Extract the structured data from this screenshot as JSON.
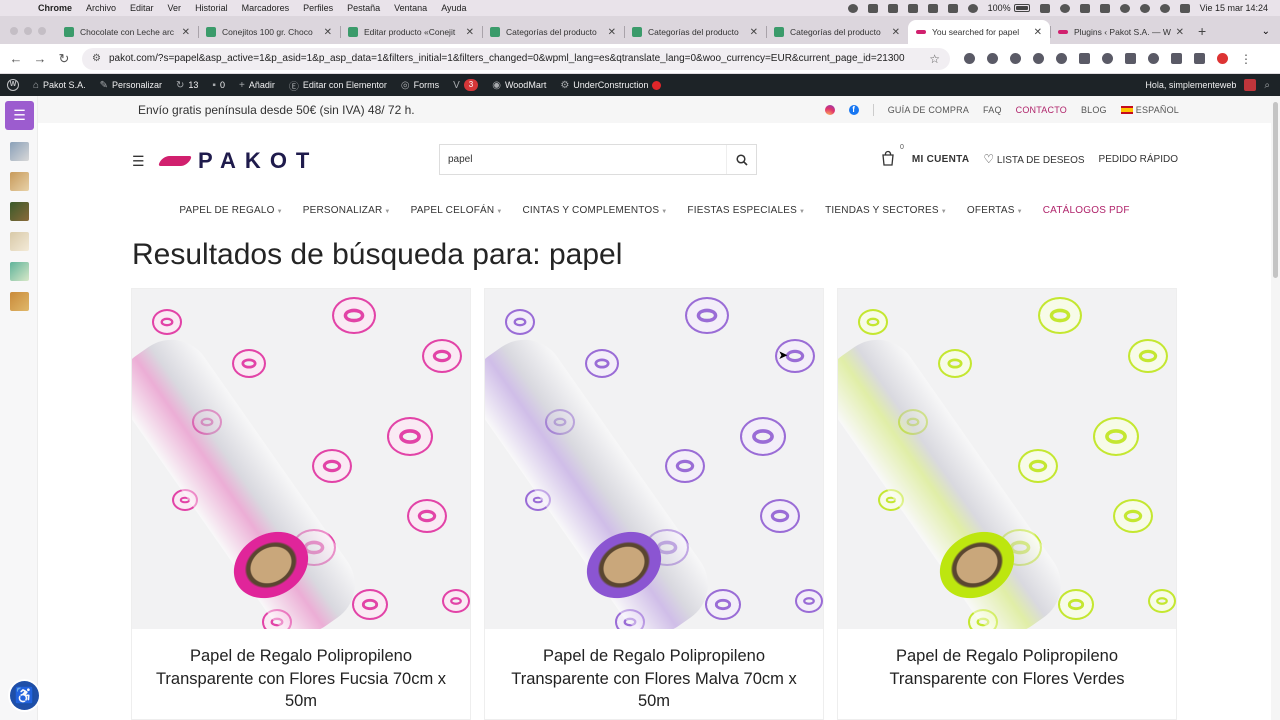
{
  "mac_menu": {
    "app": "Chrome",
    "items": [
      "Archivo",
      "Editar",
      "Ver",
      "Historial",
      "Marcadores",
      "Perfiles",
      "Pestaña",
      "Ventana",
      "Ayuda"
    ],
    "battery": "100%",
    "datetime": "Vie 15 mar  14:24"
  },
  "tabs": [
    {
      "title": "Chocolate con Leche arc",
      "color": "#3b9b6b"
    },
    {
      "title": "Conejitos 100 gr. Choco",
      "color": "#3b9b6b"
    },
    {
      "title": "Editar producto «Conejit",
      "color": "#3b9b6b"
    },
    {
      "title": "Categorías del producto",
      "color": "#3b9b6b"
    },
    {
      "title": "Categorías del producto",
      "color": "#3b9b6b"
    },
    {
      "title": "Categorías del producto",
      "color": "#3b9b6b"
    },
    {
      "title": "You searched for papel",
      "color": "#d1206e"
    },
    {
      "title": "Plugins ‹ Pakot S.A. — W",
      "color": "#d1206e"
    }
  ],
  "address": {
    "url": "pakot.com/?s=papel&asp_active=1&p_asid=1&p_asp_data=1&filters_initial=1&filters_changed=0&wpml_lang=es&qtranslate_lang=0&woo_currency=EUR&current_page_id=21300"
  },
  "wp_admin": {
    "site": "Pakot S.A.",
    "customize": "Personalizar",
    "updates": "13",
    "comments": "0",
    "add": "Añadir",
    "elementor": "Editar con Elementor",
    "forms": "Forms",
    "forms_count": "3",
    "woodmart": "WoodMart",
    "under": "UnderConstruction",
    "greeting": "Hola, simplementeweb"
  },
  "topbar": {
    "promo": "Envío gratis península desde 50€ (sin IVA) 48/ 72 h.",
    "guia": "GUÍA DE COMPRA",
    "faq": "FAQ",
    "contacto": "CONTACTO",
    "blog": "BLOG",
    "lang": "ESPAÑOL"
  },
  "header": {
    "logo": "PAKOT",
    "search_value": "papel",
    "cart_count": "0",
    "account": "MI CUENTA",
    "wishlist": "LISTA DE DESEOS",
    "quick_order": "PEDIDO RÁPIDO"
  },
  "nav": [
    "PAPEL DE REGALO",
    "PERSONALIZAR",
    "PAPEL CELOFÁN",
    "CINTAS Y COMPLEMENTOS",
    "FIESTAS ESPECIALES",
    "TIENDAS Y SECTORES",
    "OFERTAS",
    "CATÁLOGOS PDF"
  ],
  "results_title": "Resultados de búsqueda para: papel",
  "products": [
    {
      "name": "Papel de Regalo Polipropileno Transparente con Flores Fucsia 70cm x 50m",
      "color": "#e0259a"
    },
    {
      "name": "Papel de Regalo Polipropileno Transparente con Flores Malva 70cm x 50m",
      "color": "#8b55d2"
    },
    {
      "name": "Papel de Regalo Polipropileno Transparente con Flores Verdes",
      "color": "#bde60f"
    }
  ]
}
